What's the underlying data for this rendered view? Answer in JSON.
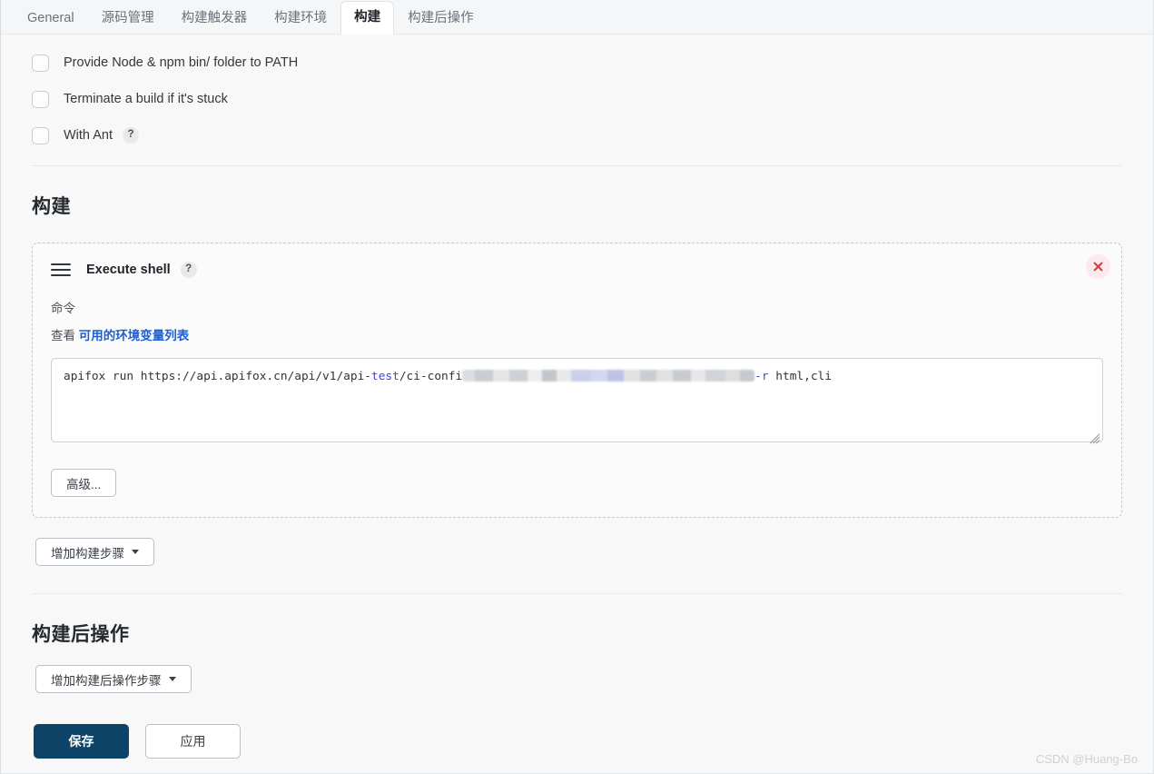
{
  "tabs": [
    {
      "label": "General",
      "active": false
    },
    {
      "label": "源码管理",
      "active": false
    },
    {
      "label": "构建触发器",
      "active": false
    },
    {
      "label": "构建环境",
      "active": false
    },
    {
      "label": "构建",
      "active": true
    },
    {
      "label": "构建后操作",
      "active": false
    }
  ],
  "build_env_checkboxes": [
    {
      "label": "Provide Node & npm bin/ folder to PATH",
      "checked": false,
      "help": false
    },
    {
      "label": "Terminate a build if it's stuck",
      "checked": false,
      "help": false
    },
    {
      "label": "With Ant",
      "checked": false,
      "help": true,
      "help_glyph": "?"
    }
  ],
  "build_section": {
    "title": "构建",
    "step": {
      "name": "Execute shell",
      "help_glyph": "?",
      "drag_handle_icon": "drag-handle-icon",
      "close_icon": "close-icon",
      "command_label": "命令",
      "env_prefix": "查看",
      "env_link": "可用的环境变量列表",
      "command_value": "apifox run https://api.apifox.cn/api/v1/api-test/ci-confi███████████████████████████████ -r html,cli",
      "command_parts": {
        "prefix_plain": "apifox run https://api.apifox.cn/api/v1/api-",
        "kw1": "test",
        "mid_plain": "/ci-confi",
        "redacted_label": "redacted-token",
        "kw2": "-r",
        "suffix_plain": " html,cli"
      },
      "advanced_button": "高级..."
    },
    "add_step_button": "增加构建步骤"
  },
  "post_build_section": {
    "title": "构建后操作",
    "add_step_button": "增加构建后操作步骤"
  },
  "footer": {
    "save_label": "保存",
    "apply_label": "应用"
  },
  "watermark": "CSDN @Huang-Bo",
  "colors": {
    "save_button": "#0e4368",
    "link": "#1b5fd0",
    "close_icon": "#e03b3b",
    "close_bg": "#fdeaec",
    "keyword": "#3b46d8",
    "page_bg": "#f8f8f8",
    "tab_bg": "#f5f6f7"
  }
}
